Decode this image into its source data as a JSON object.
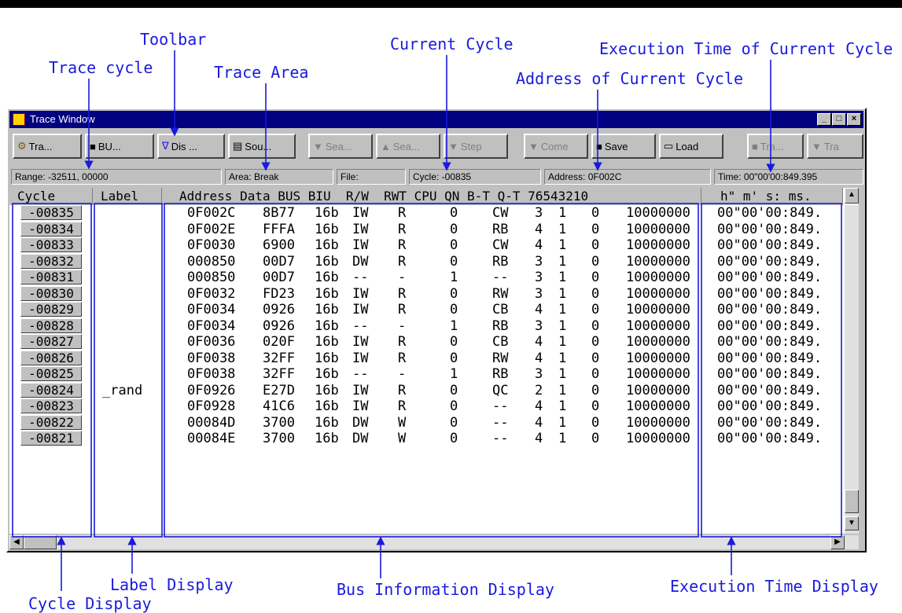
{
  "callouts": {
    "toolbar": "Toolbar",
    "trace_cycle": "Trace cycle",
    "trace_area": "Trace Area",
    "current_cycle": "Current Cycle",
    "exec_time_current": "Execution Time of Current Cycle",
    "address_current": "Address of Current Cycle",
    "label_display": "Label Display",
    "cycle_display": "Cycle Display",
    "bus_info_display": "Bus Information Display",
    "exec_time_display": "Execution Time Display"
  },
  "window": {
    "title": "Trace Window",
    "minimize": "_",
    "maximize": "□",
    "close": "×"
  },
  "toolbar": {
    "buttons": [
      {
        "label": "Tra...",
        "icon": "gear-icon"
      },
      {
        "label": "BU...",
        "icon": "bus-icon"
      },
      {
        "label": "Dis ...",
        "icon": "filter-icon"
      },
      {
        "label": "Sou...",
        "icon": "source-icon"
      },
      {
        "label": "Sea...",
        "icon": "search-down-icon"
      },
      {
        "label": "Sea...",
        "icon": "search-up-icon"
      },
      {
        "label": "Step",
        "icon": "step-icon"
      },
      {
        "label": "Come",
        "icon": "come-icon"
      },
      {
        "label": "Save",
        "icon": "save-icon"
      },
      {
        "label": "Load",
        "icon": "load-icon"
      },
      {
        "label": "Tra...",
        "icon": "trace-icon"
      },
      {
        "label": "Tra",
        "icon": "trace-down-icon"
      }
    ]
  },
  "status": {
    "range": "Range: -32511, 00000",
    "area": "Area: Break",
    "file": "File:",
    "cycle": "Cycle: -00835",
    "address": "Address: 0F002C",
    "time": "Time: 00\"00'00:849.395"
  },
  "columns": {
    "cycle": "Cycle",
    "label": "Label",
    "bus": "Address Data BUS BIU  R/W  RWT CPU QN B-T Q-T 76543210",
    "time": "h\" m' s: ms."
  },
  "rows": [
    {
      "cycle": "-00835",
      "label": "",
      "address": "0F002C",
      "data": "8B77",
      "bus": "16b",
      "biu": "IW",
      "rw": "R",
      "rwt": "0",
      "cpu": "CW",
      "qn": "3",
      "bt": "1",
      "qt": "0",
      "bits": "10000000",
      "time": "00\"00'00:849."
    },
    {
      "cycle": "-00834",
      "label": "",
      "address": "0F002E",
      "data": "FFFA",
      "bus": "16b",
      "biu": "IW",
      "rw": "R",
      "rwt": "0",
      "cpu": "RB",
      "qn": "4",
      "bt": "1",
      "qt": "0",
      "bits": "10000000",
      "time": "00\"00'00:849."
    },
    {
      "cycle": "-00833",
      "label": "",
      "address": "0F0030",
      "data": "6900",
      "bus": "16b",
      "biu": "IW",
      "rw": "R",
      "rwt": "0",
      "cpu": "CW",
      "qn": "4",
      "bt": "1",
      "qt": "0",
      "bits": "10000000",
      "time": "00\"00'00:849."
    },
    {
      "cycle": "-00832",
      "label": "",
      "address": "000850",
      "data": "00D7",
      "bus": "16b",
      "biu": "DW",
      "rw": "R",
      "rwt": "0",
      "cpu": "RB",
      "qn": "3",
      "bt": "1",
      "qt": "0",
      "bits": "10000000",
      "time": "00\"00'00:849."
    },
    {
      "cycle": "-00831",
      "label": "",
      "address": "000850",
      "data": "00D7",
      "bus": "16b",
      "biu": "--",
      "rw": "-",
      "rwt": "1",
      "cpu": "--",
      "qn": "3",
      "bt": "1",
      "qt": "0",
      "bits": "10000000",
      "time": "00\"00'00:849."
    },
    {
      "cycle": "-00830",
      "label": "",
      "address": "0F0032",
      "data": "FD23",
      "bus": "16b",
      "biu": "IW",
      "rw": "R",
      "rwt": "0",
      "cpu": "RW",
      "qn": "3",
      "bt": "1",
      "qt": "0",
      "bits": "10000000",
      "time": "00\"00'00:849."
    },
    {
      "cycle": "-00829",
      "label": "",
      "address": "0F0034",
      "data": "0926",
      "bus": "16b",
      "biu": "IW",
      "rw": "R",
      "rwt": "0",
      "cpu": "CB",
      "qn": "4",
      "bt": "1",
      "qt": "0",
      "bits": "10000000",
      "time": "00\"00'00:849."
    },
    {
      "cycle": "-00828",
      "label": "",
      "address": "0F0034",
      "data": "0926",
      "bus": "16b",
      "biu": "--",
      "rw": "-",
      "rwt": "1",
      "cpu": "RB",
      "qn": "3",
      "bt": "1",
      "qt": "0",
      "bits": "10000000",
      "time": "00\"00'00:849."
    },
    {
      "cycle": "-00827",
      "label": "",
      "address": "0F0036",
      "data": "020F",
      "bus": "16b",
      "biu": "IW",
      "rw": "R",
      "rwt": "0",
      "cpu": "CB",
      "qn": "4",
      "bt": "1",
      "qt": "0",
      "bits": "10000000",
      "time": "00\"00'00:849."
    },
    {
      "cycle": "-00826",
      "label": "",
      "address": "0F0038",
      "data": "32FF",
      "bus": "16b",
      "biu": "IW",
      "rw": "R",
      "rwt": "0",
      "cpu": "RW",
      "qn": "4",
      "bt": "1",
      "qt": "0",
      "bits": "10000000",
      "time": "00\"00'00:849."
    },
    {
      "cycle": "-00825",
      "label": "",
      "address": "0F0038",
      "data": "32FF",
      "bus": "16b",
      "biu": "--",
      "rw": "-",
      "rwt": "1",
      "cpu": "RB",
      "qn": "3",
      "bt": "1",
      "qt": "0",
      "bits": "10000000",
      "time": "00\"00'00:849."
    },
    {
      "cycle": "-00824",
      "label": "_rand",
      "address": "0F0926",
      "data": "E27D",
      "bus": "16b",
      "biu": "IW",
      "rw": "R",
      "rwt": "0",
      "cpu": "QC",
      "qn": "2",
      "bt": "1",
      "qt": "0",
      "bits": "10000000",
      "time": "00\"00'00:849."
    },
    {
      "cycle": "-00823",
      "label": "",
      "address": "0F0928",
      "data": "41C6",
      "bus": "16b",
      "biu": "IW",
      "rw": "R",
      "rwt": "0",
      "cpu": "--",
      "qn": "4",
      "bt": "1",
      "qt": "0",
      "bits": "10000000",
      "time": "00\"00'00:849."
    },
    {
      "cycle": "-00822",
      "label": "",
      "address": "00084D",
      "data": "3700",
      "bus": "16b",
      "biu": "DW",
      "rw": "W",
      "rwt": "0",
      "cpu": "--",
      "qn": "4",
      "bt": "1",
      "qt": "0",
      "bits": "10000000",
      "time": "00\"00'00:849."
    },
    {
      "cycle": "-00821",
      "label": "",
      "address": "00084E",
      "data": "3700",
      "bus": "16b",
      "biu": "DW",
      "rw": "W",
      "rwt": "0",
      "cpu": "--",
      "qn": "4",
      "bt": "1",
      "qt": "0",
      "bits": "10000000",
      "time": "00\"00'00:849."
    }
  ],
  "colors": {
    "accent": "#1a1adc",
    "titlebar": "#000080",
    "face": "#c0c0c0"
  }
}
